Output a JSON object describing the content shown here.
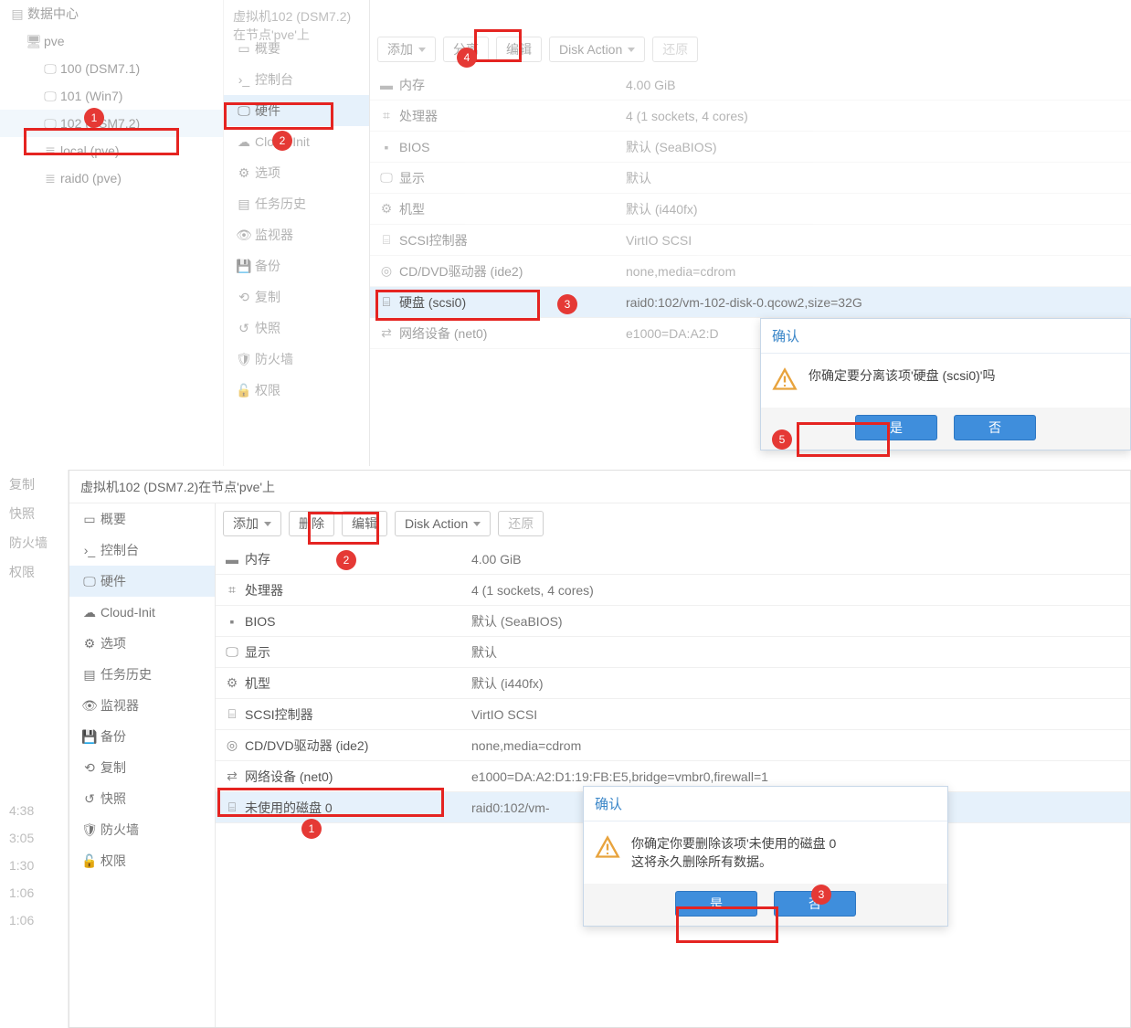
{
  "top": {
    "tree": {
      "title": "数据中心",
      "node": "pve",
      "vms": [
        {
          "label": "100 (DSM7.1)"
        },
        {
          "label": "101 (Win7)"
        },
        {
          "label": "102 (DSM7.2)"
        }
      ],
      "storages": [
        {
          "label": "local (pve)"
        },
        {
          "label": "raid0 (pve)"
        }
      ]
    },
    "header": "虚拟机102 (DSM7.2)在节点'pve'上",
    "nav": {
      "summary": "概要",
      "console": "控制台",
      "hardware": "硬件",
      "cloudinit": "Cloud-Init",
      "options": "选项",
      "history": "任务历史",
      "monitor": "监视器",
      "backup": "备份",
      "replicate": "复制",
      "snapshot": "快照",
      "firewall": "防火墙",
      "permission": "权限"
    },
    "toolbar": {
      "add": "添加",
      "detach": "分离",
      "edit": "编辑",
      "diskaction": "Disk Action",
      "restore": "还原"
    },
    "hw": [
      {
        "icon": "mem",
        "label": "内存",
        "value": "4.00 GiB"
      },
      {
        "icon": "cpu",
        "label": "处理器",
        "value": "4 (1 sockets, 4 cores)"
      },
      {
        "icon": "bios",
        "label": "BIOS",
        "value": "默认 (SeaBIOS)"
      },
      {
        "icon": "display",
        "label": "显示",
        "value": "默认"
      },
      {
        "icon": "gear",
        "label": "机型",
        "value": "默认 (i440fx)"
      },
      {
        "icon": "hdd",
        "label": "SCSI控制器",
        "value": "VirtIO SCSI"
      },
      {
        "icon": "cd",
        "label": "CD/DVD驱动器 (ide2)",
        "value": "none,media=cdrom"
      },
      {
        "icon": "hdd",
        "label": "硬盘 (scsi0)",
        "value": "raid0:102/vm-102-disk-0.qcow2,size=32G",
        "selected": true
      },
      {
        "icon": "net",
        "label": "网络设备 (net0)",
        "value": "e1000=DA:A2:D"
      }
    ],
    "dialog": {
      "title": "确认",
      "message": "你确定要分离该项'硬盘 (scsi0)'吗",
      "yes": "是",
      "no": "否"
    },
    "badges": {
      "1": "1",
      "2": "2",
      "3": "3",
      "4": "4",
      "5": "5"
    }
  },
  "bottom": {
    "leftstrip": {
      "items": [
        "复制",
        "快照",
        "防火墙",
        "权限"
      ],
      "times": [
        "4:38",
        "3:05",
        "1:30",
        "1:06",
        "1:06"
      ]
    },
    "header": "虚拟机102 (DSM7.2)在节点'pve'上",
    "nav": {
      "summary": "概要",
      "console": "控制台",
      "hardware": "硬件",
      "cloudinit": "Cloud-Init",
      "options": "选项",
      "history": "任务历史",
      "monitor": "监视器",
      "backup": "备份",
      "replicate": "复制",
      "snapshot": "快照",
      "firewall": "防火墙",
      "permission": "权限"
    },
    "toolbar": {
      "add": "添加",
      "remove": "删除",
      "edit": "编辑",
      "diskaction": "Disk Action",
      "restore": "还原"
    },
    "hw": [
      {
        "icon": "mem",
        "label": "内存",
        "value": "4.00 GiB"
      },
      {
        "icon": "cpu",
        "label": "处理器",
        "value": "4 (1 sockets, 4 cores)"
      },
      {
        "icon": "bios",
        "label": "BIOS",
        "value": "默认 (SeaBIOS)"
      },
      {
        "icon": "display",
        "label": "显示",
        "value": "默认"
      },
      {
        "icon": "gear",
        "label": "机型",
        "value": "默认 (i440fx)"
      },
      {
        "icon": "hdd",
        "label": "SCSI控制器",
        "value": "VirtIO SCSI"
      },
      {
        "icon": "cd",
        "label": "CD/DVD驱动器 (ide2)",
        "value": "none,media=cdrom"
      },
      {
        "icon": "net",
        "label": "网络设备 (net0)",
        "value": "e1000=DA:A2:D1:19:FB:E5,bridge=vmbr0,firewall=1"
      },
      {
        "icon": "hdd",
        "label": "未使用的磁盘 0",
        "value": "raid0:102/vm-",
        "selected": true
      }
    ],
    "dialog": {
      "title": "确认",
      "message1": "你确定你要删除该项'未使用的磁盘 0",
      "message2": "这将永久删除所有数据。",
      "yes": "是",
      "no": "否"
    },
    "badges": {
      "1": "1",
      "2": "2",
      "3": "3"
    }
  }
}
